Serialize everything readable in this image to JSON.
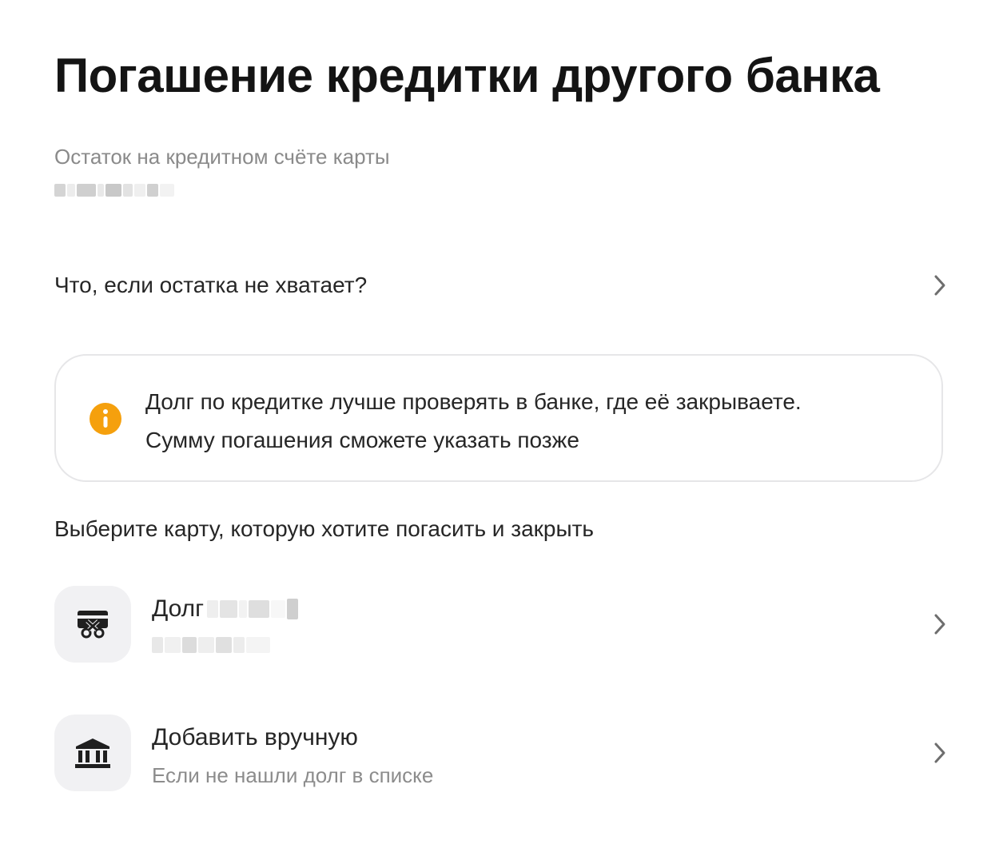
{
  "page": {
    "title": "Погашение кредитки другого банка"
  },
  "balance": {
    "label": "Остаток на кредитном счёте карты"
  },
  "help_link": {
    "label": "Что, если остатка не хватает?",
    "icon": "chevron-right-icon"
  },
  "info_card": {
    "icon": "info-icon",
    "accent_color": "#F5A00D",
    "line1": "Долг по кредитке лучше проверять в банке, где её закрываете.",
    "line2": "Сумму погашения сможете указать позже"
  },
  "card_select": {
    "label": "Выберите карту, которую хотите погасить и закрыть",
    "items": [
      {
        "title": "Долг",
        "icon": "card-cut-icon"
      },
      {
        "title": "Добавить вручную",
        "subtitle": "Если не нашли долг в списке",
        "icon": "bank-icon"
      }
    ]
  }
}
